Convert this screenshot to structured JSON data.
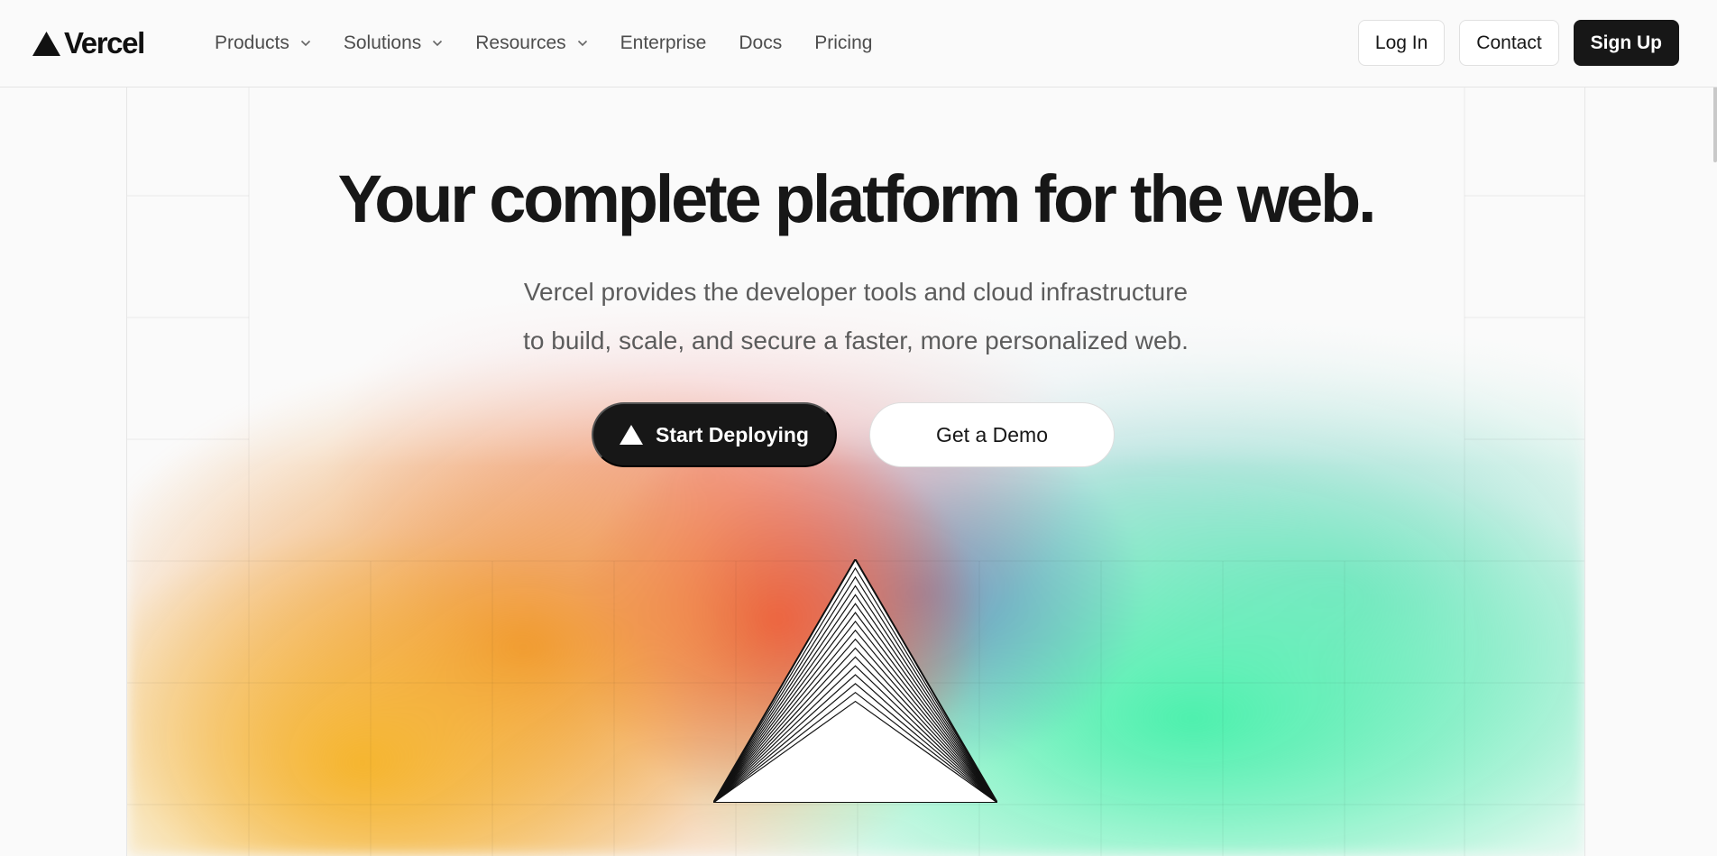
{
  "brand": {
    "name": "Vercel",
    "logo_icon": "triangle-logo-icon"
  },
  "nav": {
    "links": [
      {
        "label": "Products",
        "has_dropdown": true
      },
      {
        "label": "Solutions",
        "has_dropdown": true
      },
      {
        "label": "Resources",
        "has_dropdown": true
      },
      {
        "label": "Enterprise",
        "has_dropdown": false
      },
      {
        "label": "Docs",
        "has_dropdown": false
      },
      {
        "label": "Pricing",
        "has_dropdown": false
      }
    ],
    "login_label": "Log In",
    "contact_label": "Contact",
    "signup_label": "Sign Up"
  },
  "hero": {
    "headline": "Your complete platform for the web.",
    "subhead_line1": "Vercel provides the developer tools and cloud infrastructure",
    "subhead_line2": "to build, scale, and secure a faster, more personalized web.",
    "primary_cta": "Start Deploying",
    "secondary_cta": "Get a Demo"
  },
  "colors": {
    "text": "#171717",
    "muted": "#5c5c5c",
    "background": "#fafafa",
    "glow_orange": "#EE8C28",
    "glow_red": "#EC4650",
    "glow_blue": "#5A82BE",
    "glow_green": "#46F0AA",
    "glow_yellow": "#F5B428"
  }
}
